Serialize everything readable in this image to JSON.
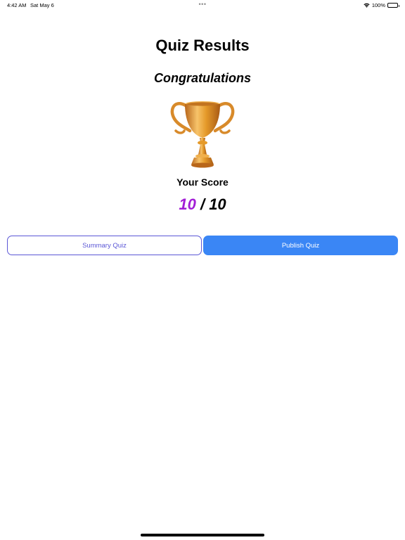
{
  "status_bar": {
    "time": "4:42 AM",
    "date": "Sat May 6",
    "dots": "•••",
    "battery_text": "100%",
    "icons": [
      "wifi-icon",
      "battery-icon"
    ]
  },
  "header": {
    "title": "Quiz Results",
    "subtitle": "Congratulations"
  },
  "trophy": {
    "icon": "trophy-icon",
    "colors": {
      "gold_light": "#f7c36a",
      "gold_mid": "#e59a2a",
      "gold_dark": "#b8661a"
    }
  },
  "score": {
    "label": "Your Score",
    "value": "10",
    "separator": "/",
    "total": "10",
    "value_color": "#a21ed6"
  },
  "actions": {
    "summary_label": "Summary Quiz",
    "publish_label": "Publish Quiz",
    "summary_color": "#5b57d6",
    "publish_color": "#3a86f5"
  }
}
